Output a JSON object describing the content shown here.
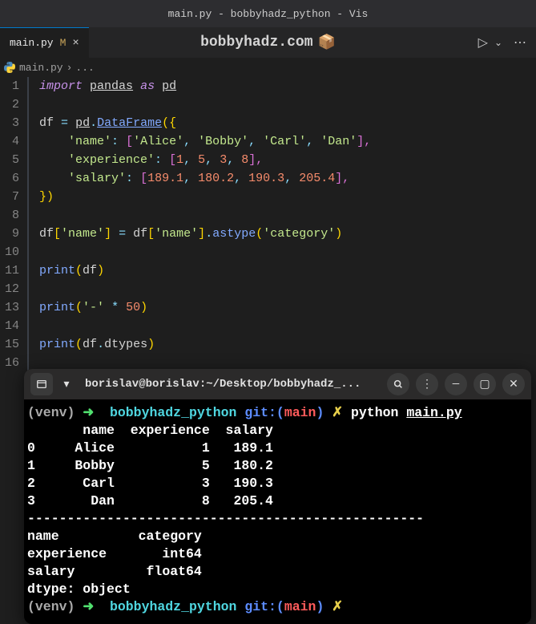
{
  "window": {
    "title": "main.py - bobbyhadz_python - Vis"
  },
  "tab": {
    "label": "main.py",
    "modified_indicator": "M",
    "close": "×"
  },
  "watermark": {
    "text": "bobbyhadz.com",
    "icon": "📦"
  },
  "run": {
    "play": "▷",
    "chevron": "⌄",
    "more": "⋯"
  },
  "breadcrumb": {
    "file": "main.py",
    "sep": "›",
    "more": "..."
  },
  "code": {
    "lines": [
      "1",
      "2",
      "3",
      "4",
      "5",
      "6",
      "7",
      "8",
      "9",
      "10",
      "11",
      "12",
      "13",
      "14",
      "15",
      "16"
    ],
    "l1": {
      "import": "import",
      "pandas": "pandas",
      "as": "as",
      "pd": "pd"
    },
    "l3": {
      "df": "df",
      "eq": "=",
      "pd": "pd",
      "dot": ".",
      "dataframe": "DataFrame",
      "open": "({"
    },
    "l4": {
      "key": "'name'",
      "colon": ":",
      "open": "[",
      "v1": "'Alice'",
      "v2": "'Bobby'",
      "v3": "'Carl'",
      "v4": "'Dan'",
      "close": "],",
      "c": ","
    },
    "l5": {
      "key": "'experience'",
      "colon": ":",
      "open": "[",
      "v1": "1",
      "v2": "5",
      "v3": "3",
      "v4": "8",
      "close": "],",
      "c": ","
    },
    "l6": {
      "key": "'salary'",
      "colon": ":",
      "open": "[",
      "v1": "189.1",
      "v2": "180.2",
      "v3": "190.3",
      "v4": "205.4",
      "close": "],",
      "c": ","
    },
    "l7": {
      "close": "})"
    },
    "l9": {
      "df": "df",
      "open1": "[",
      "name1": "'name'",
      "close1": "]",
      "eq": "=",
      "df2": "df",
      "open2": "[",
      "name2": "'name'",
      "close2": "]",
      "dot": ".",
      "astype": "astype",
      "paren_o": "(",
      "cat": "'category'",
      "paren_c": ")"
    },
    "l11": {
      "print": "print",
      "open": "(",
      "df": "df",
      "close": ")"
    },
    "l13": {
      "print": "print",
      "open": "(",
      "dash": "'-'",
      "star": "*",
      "fifty": "50",
      "close": ")"
    },
    "l15": {
      "print": "print",
      "open": "(",
      "df": "df",
      "dot": ".",
      "dtypes": "dtypes",
      "close": ")"
    }
  },
  "terminal": {
    "header": {
      "new_tab": "▾",
      "title": "borislav@borislav:~/Desktop/bobbyhadz_...",
      "search": "🔍",
      "menu": "⋮",
      "min": "—",
      "max": "▢",
      "close": "✕"
    },
    "p1": {
      "venv": "(venv)",
      "arrow": "➜",
      "dir": "bobbyhadz_python",
      "git": "git:(",
      "branch": "main",
      "gitend": ")",
      "dirty": "✗",
      "cmd": "python",
      "file": "main.py"
    },
    "out": {
      "h": "       name  experience  salary",
      "r0": "0     Alice           1   189.1",
      "r1": "1     Bobby           5   180.2",
      "r2": "2      Carl           3   190.3",
      "r3": "3       Dan           8   205.4",
      "sep": "--------------------------------------------------",
      "d1": "name          category",
      "d2": "experience       int64",
      "d3": "salary         float64",
      "d4": "dtype: object"
    },
    "p2": {
      "venv": "(venv)",
      "arrow": "➜",
      "dir": "bobbyhadz_python",
      "git": "git:(",
      "branch": "main",
      "gitend": ")",
      "dirty": "✗"
    }
  },
  "chart_data": {
    "type": "table",
    "title": "DataFrame output",
    "columns": [
      "name",
      "experience",
      "salary"
    ],
    "rows": [
      {
        "name": "Alice",
        "experience": 1,
        "salary": 189.1
      },
      {
        "name": "Bobby",
        "experience": 5,
        "salary": 180.2
      },
      {
        "name": "Carl",
        "experience": 3,
        "salary": 190.3
      },
      {
        "name": "Dan",
        "experience": 8,
        "salary": 205.4
      }
    ],
    "dtypes": {
      "name": "category",
      "experience": "int64",
      "salary": "float64"
    }
  }
}
